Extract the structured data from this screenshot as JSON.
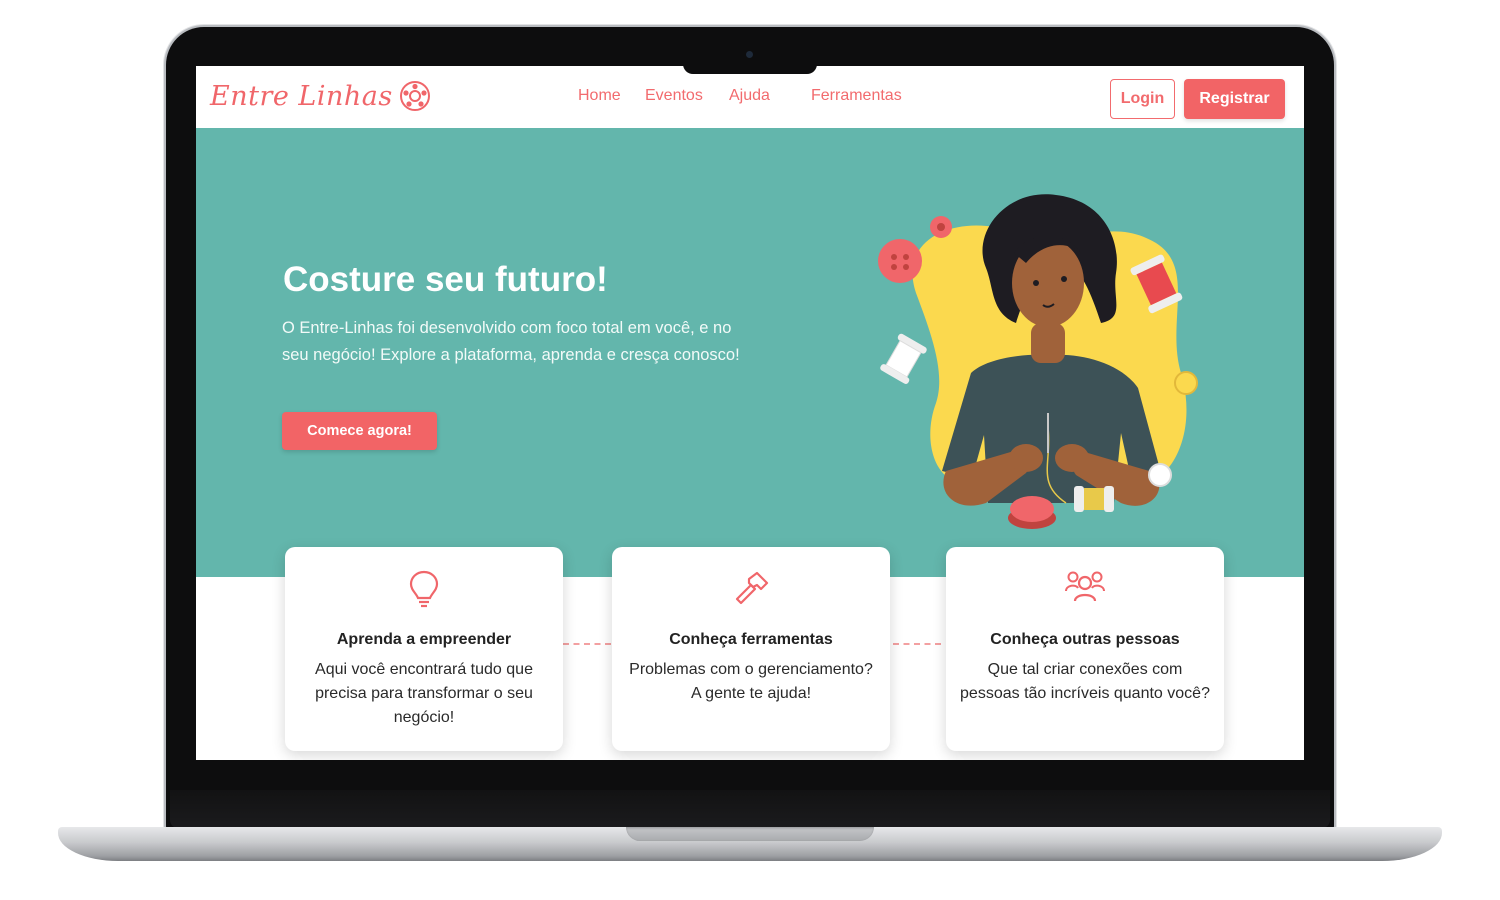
{
  "brand": {
    "name": "Entre Linhas",
    "color": "#f0666a"
  },
  "nav": {
    "links": [
      "Home",
      "Eventos",
      "Ajuda",
      "Ferramentas"
    ],
    "login_label": "Login",
    "register_label": "Registrar"
  },
  "hero": {
    "title": "Costure seu futuro!",
    "text": "O Entre-Linhas foi desenvolvido com foco total em você, e no seu negócio! Explore a plataforma, aprenda e cresça conosco!",
    "cta_label": "Comece agora!",
    "background_color": "#63b6ac"
  },
  "features": [
    {
      "icon": "lightbulb-icon",
      "title": "Aprenda a empreender",
      "text": "Aqui você encontrará tudo que precisa para transformar o seu negócio!"
    },
    {
      "icon": "hammer-icon",
      "title": "Conheça ferramentas",
      "text": "Problemas com o gerenciamento? A gente te ajuda!"
    },
    {
      "icon": "people-icon",
      "title": "Conheça outras pessoas",
      "text": "Que tal criar conexões com pessoas tão incríveis quanto você?"
    }
  ],
  "accent_color": "#f26466"
}
